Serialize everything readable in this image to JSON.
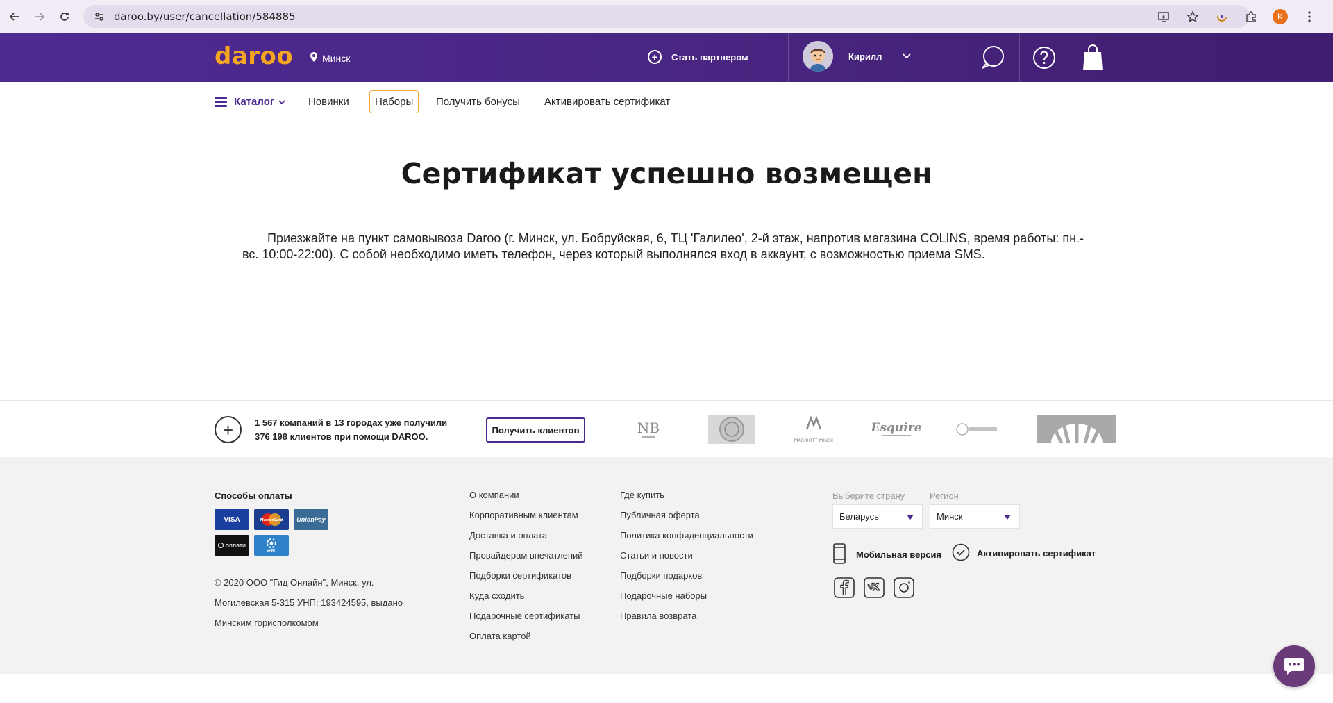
{
  "browser": {
    "url": "daroo.by/user/cancellation/584885",
    "profile_initial": "K"
  },
  "header": {
    "logo": "daroo",
    "city": "Минск",
    "partner_label": "Стать партнером",
    "user_name": "Кирилл"
  },
  "nav": {
    "catalog": "Каталог",
    "items": [
      "Новинки",
      "Наборы",
      "Получить бонусы",
      "Активировать сертификат"
    ]
  },
  "main": {
    "title": "Сертификат успешно возмещен",
    "text": "Приезжайте на пункт самовывоза Daroo (г. Минск, ул. Бобруйская, 6, ТЦ 'Галилео', 2-й этаж, напротив магазина COLINS, время работы: пн.-вс. 10:00-22:00). С собой необходимо иметь телефон, через который выполнялся вход в аккаунт, с возможностью приема SMS."
  },
  "partners": {
    "text_line1": "1 567 компаний в 13 городах уже получили",
    "text_line2": "376 198 клиентов при помощи DAROO.",
    "button": "Получить клиентов",
    "brands": [
      "NB",
      "Esquire",
      "MARRIOTT MINSK"
    ]
  },
  "footer": {
    "payment_heading": "Способы оплаты",
    "payment_cards": [
      "VISA",
      "MasterCard",
      "UnionPay",
      "оплати",
      "ЕРИП"
    ],
    "copyright_lines": [
      "© 2020 ООО \"Гид Онлайн\", Минск, ул.",
      "Могилевская 5-315 УНП: 193424595, выдано",
      "Минским горисполкомом"
    ],
    "col1": [
      "О компании",
      "Корпоративным клиентам",
      "Доставка и оплата",
      "Провайдерам впечатлений",
      "Подборки сертификатов",
      "Куда сходить",
      "Подарочные сертификаты",
      "Оплата картой"
    ],
    "col2": [
      "Где купить",
      "Публичная оферта",
      "Политика конфиденциальности",
      "Статьи и новости",
      "Подборки подарков",
      "Подарочные наборы",
      "Правила возврата"
    ],
    "country_label": "Выберите страну",
    "country_value": "Беларусь",
    "region_label": "Регион",
    "region_value": "Минск",
    "mobile_version": "Мобильная версия",
    "activate_certificate": "Активировать сертификат"
  },
  "colors": {
    "brand_purple": "#4b2a8f",
    "logo_orange": "#f4a522",
    "chat_purple": "#6b3a78"
  }
}
